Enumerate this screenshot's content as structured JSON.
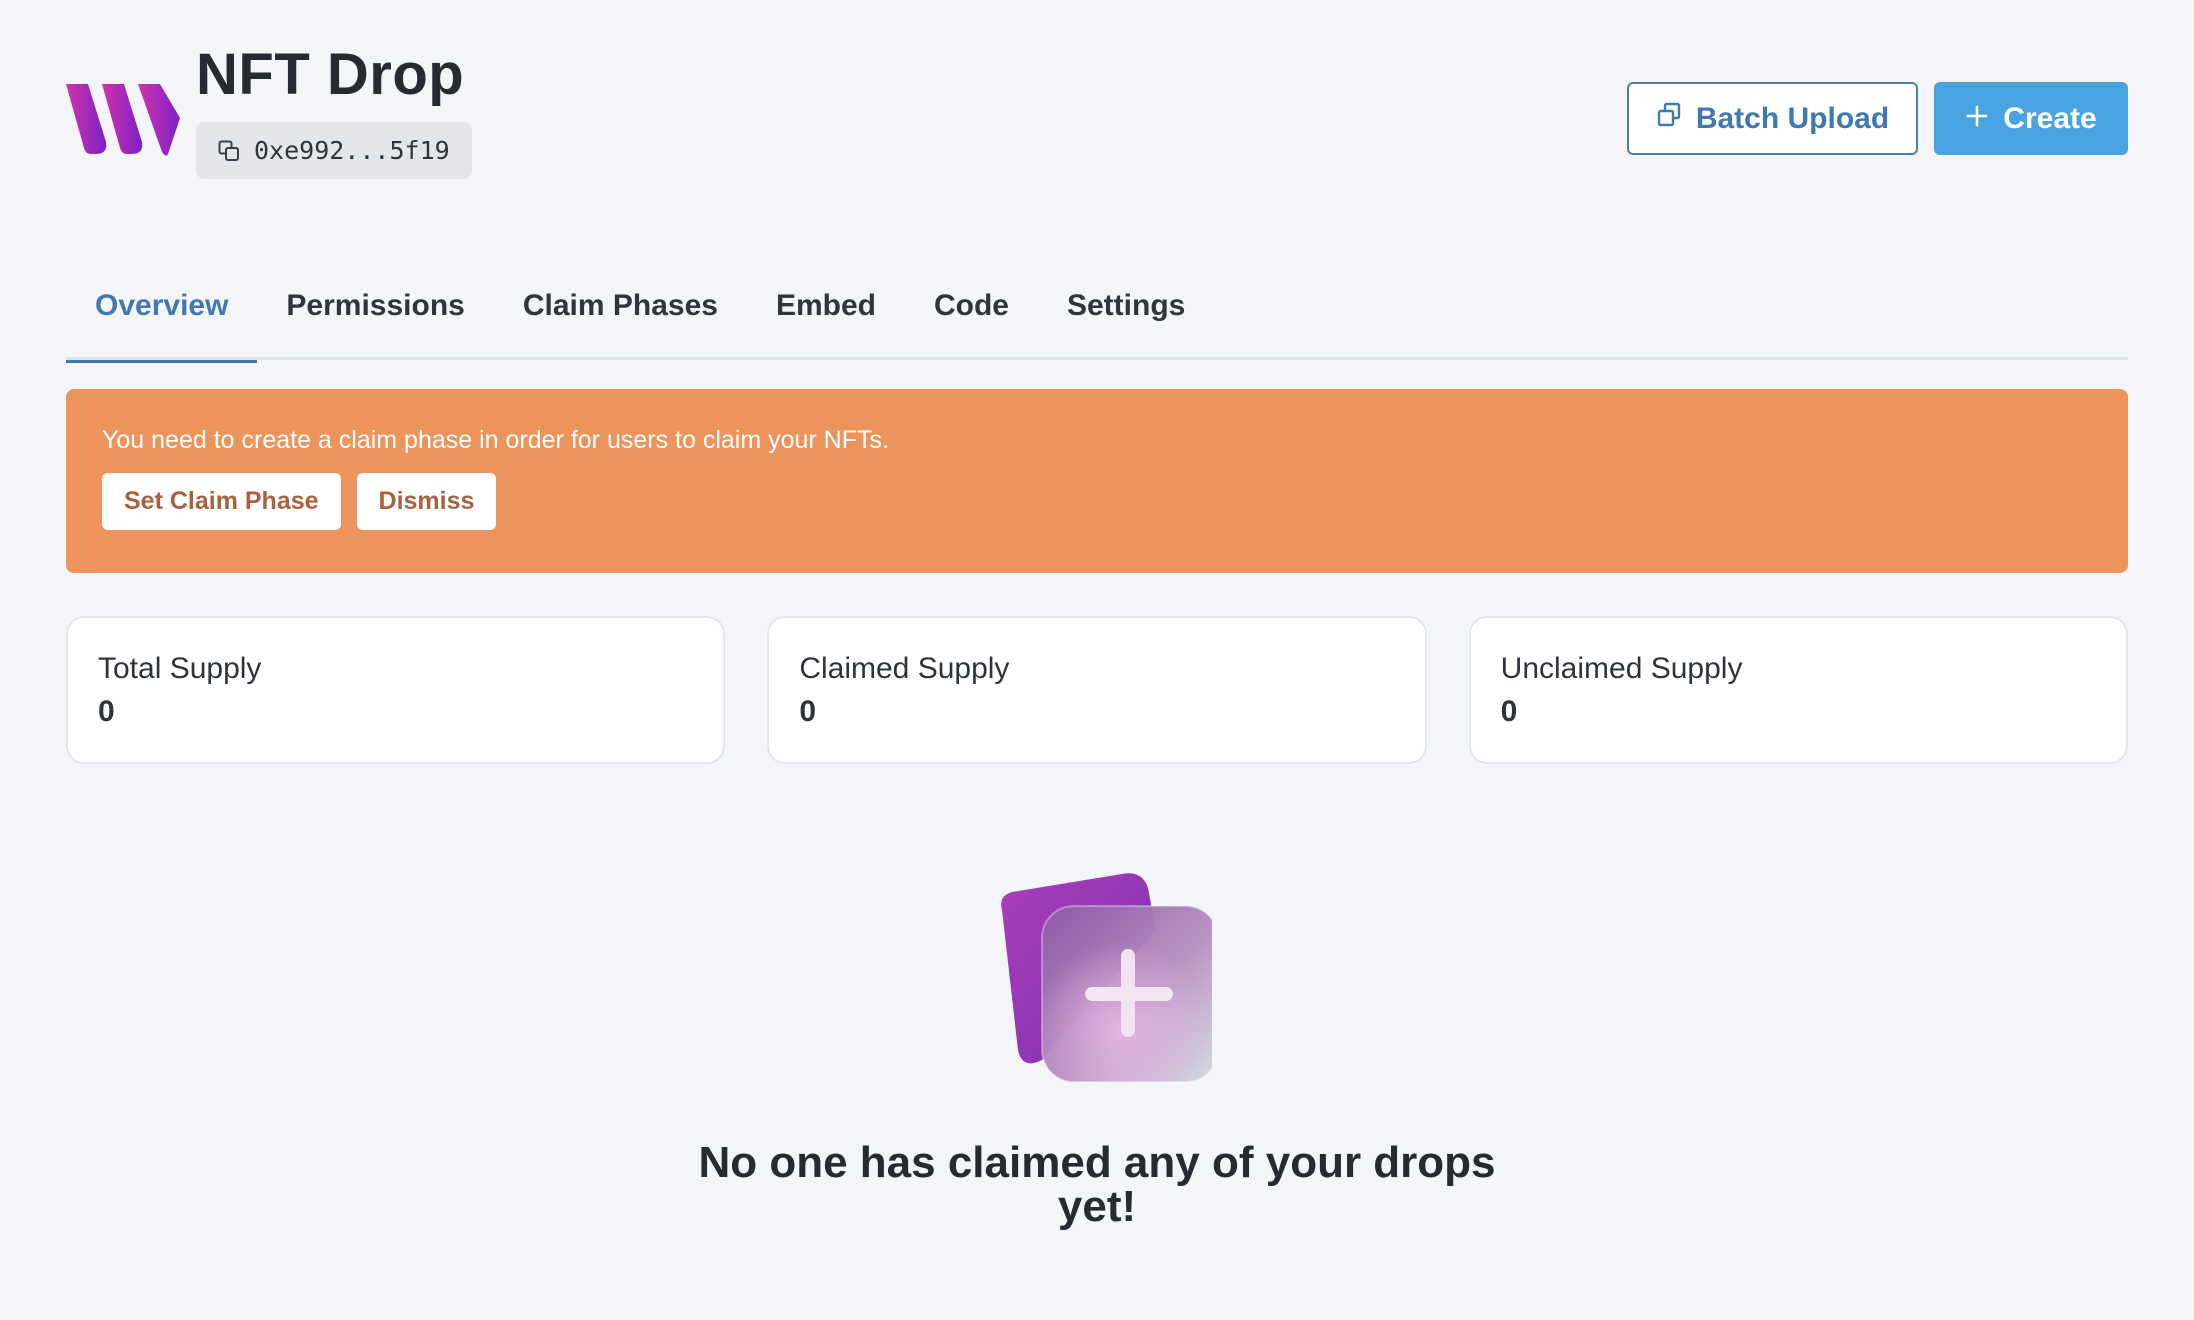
{
  "header": {
    "title": "NFT Drop",
    "address": "0xe992...5f19",
    "batch_upload_label": "Batch Upload",
    "create_label": "Create"
  },
  "tabs": [
    {
      "label": "Overview",
      "active": true
    },
    {
      "label": "Permissions",
      "active": false
    },
    {
      "label": "Claim Phases",
      "active": false
    },
    {
      "label": "Embed",
      "active": false
    },
    {
      "label": "Code",
      "active": false
    },
    {
      "label": "Settings",
      "active": false
    }
  ],
  "alert": {
    "message": "You need to create a claim phase in order for users to claim your NFTs.",
    "set_claim_phase_label": "Set Claim Phase",
    "dismiss_label": "Dismiss"
  },
  "stats": [
    {
      "label": "Total Supply",
      "value": "0"
    },
    {
      "label": "Claimed Supply",
      "value": "0"
    },
    {
      "label": "Unclaimed Supply",
      "value": "0"
    }
  ],
  "empty_state": {
    "title": "No one has claimed any of your drops yet!"
  },
  "colors": {
    "accent": "#3f79ad",
    "primary_button": "#4aa3e1",
    "alert_bg": "#eb955d",
    "background": "#f4f5f8"
  },
  "icons": {
    "logo": "brand-logo-icon",
    "copy": "copy-icon",
    "batch": "duplicate-icon",
    "create": "plus-icon",
    "empty": "add-card-illustration"
  }
}
